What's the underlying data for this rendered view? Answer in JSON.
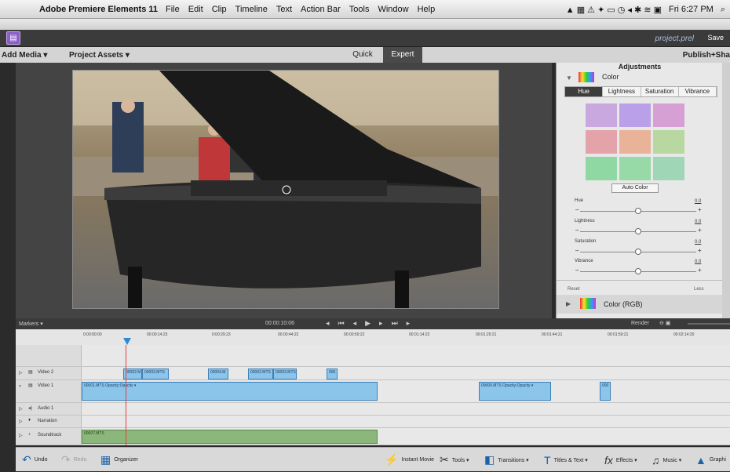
{
  "menubar": {
    "app_name": "Adobe Premiere Elements 11",
    "items": [
      "File",
      "Edit",
      "Clip",
      "Timeline",
      "Text",
      "Action Bar",
      "Tools",
      "Window",
      "Help"
    ],
    "clock": "Fri 6:27 PM"
  },
  "appbar": {
    "project_name": "project.prel",
    "save_label": "Save"
  },
  "modebar": {
    "add_media": "Add Media ▾",
    "project_assets": "Project Assets ▾",
    "tab_quick": "Quick",
    "tab_expert": "Expert",
    "publish_share": "Publish+Sha"
  },
  "adjustments": {
    "title": "Adjustments",
    "section_color": "Color",
    "subtabs": [
      "Hue",
      "Lightness",
      "Saturation",
      "Vibrance"
    ],
    "auto_color": "Auto Color",
    "sliders": [
      {
        "label": "Hue",
        "value": "0.0",
        "level": 0.5
      },
      {
        "label": "Lightness",
        "value": "0.0",
        "level": 0.5
      },
      {
        "label": "Saturation",
        "value": "0.0",
        "level": 0.5
      },
      {
        "label": "Vibrance",
        "value": "0.0",
        "level": 0.5
      }
    ],
    "reset": "Reset",
    "less": "Less",
    "section_rgb": "Color (RGB)"
  },
  "markers_bar": {
    "markers": "Markers ▾",
    "current_time": "00:00:10:06",
    "render": "Render"
  },
  "ruler": {
    "ticks": [
      "0:00:00:00",
      "00:00:14:23",
      "0:00:29:23",
      "00:00:44:22",
      "00:00:59:22",
      "00:01:14:22",
      "00:01:29:21",
      "00:01:44:21",
      "00:01:59:21",
      "00:02:14:20"
    ]
  },
  "tracks": [
    {
      "name": "Video 2"
    },
    {
      "name": "Video 1"
    },
    {
      "name": "Audio 1"
    },
    {
      "name": "Narration"
    },
    {
      "name": "Soundtrack"
    }
  ],
  "clips": {
    "video2": [
      "00002.M",
      "00003.MTS",
      "00004.M",
      "00002.MTS",
      "00003.MTS",
      "000"
    ],
    "video1": [
      "00001.MTS  Opacity:Opacity ▾",
      "00000.MTS  Opacity:Opacity ▾",
      "000"
    ],
    "soundtrack": [
      "00007.MTS"
    ]
  },
  "bottombar": {
    "undo": "Undo",
    "redo": "Redo",
    "organizer": "Organizer",
    "instant_movie": "Instant Movie",
    "tools": "Tools ▾",
    "transitions": "Transitions ▾",
    "titles": "Titles & Text ▾",
    "effects": "Effects ▾",
    "music": "Music ▾",
    "graphics": "Graphi"
  },
  "colors": {
    "accent": "#1f62a8",
    "clip_blue": "#8cc5ea",
    "soundtrack_green": "#8bb87a"
  }
}
